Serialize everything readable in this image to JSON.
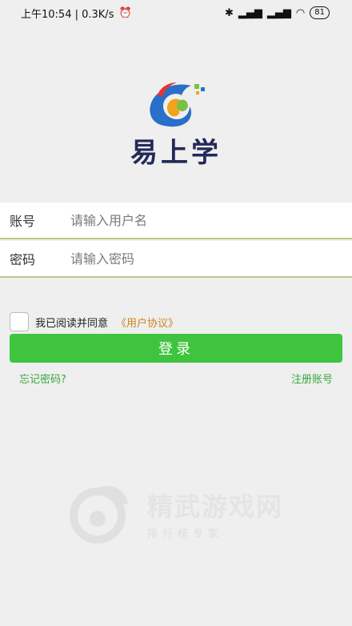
{
  "status_bar": {
    "time": "上午10:54 | 0.3K/s",
    "icons": [
      "alarm-icon",
      "bluetooth-icon",
      "signal-hd-icon",
      "signal-icon",
      "wifi-icon"
    ],
    "battery": "81"
  },
  "logo": {
    "title": "易上学"
  },
  "form": {
    "account_label": "账号",
    "account_placeholder": "请输入用户名",
    "password_label": "密码",
    "password_placeholder": "请输入密码"
  },
  "agreement": {
    "text": "我已阅读并同意",
    "link": "《用户协议》",
    "checked": false
  },
  "login_button": "登录",
  "links": {
    "forgot": "忘记密码?",
    "register": "注册账号"
  },
  "watermark": {
    "title": "精武游戏网",
    "subtitle": "排行榜专家"
  },
  "colors": {
    "accent_green": "#3fc43f",
    "link_green": "#3aa640",
    "link_orange": "#c9861e",
    "logo_text": "#232a58"
  }
}
